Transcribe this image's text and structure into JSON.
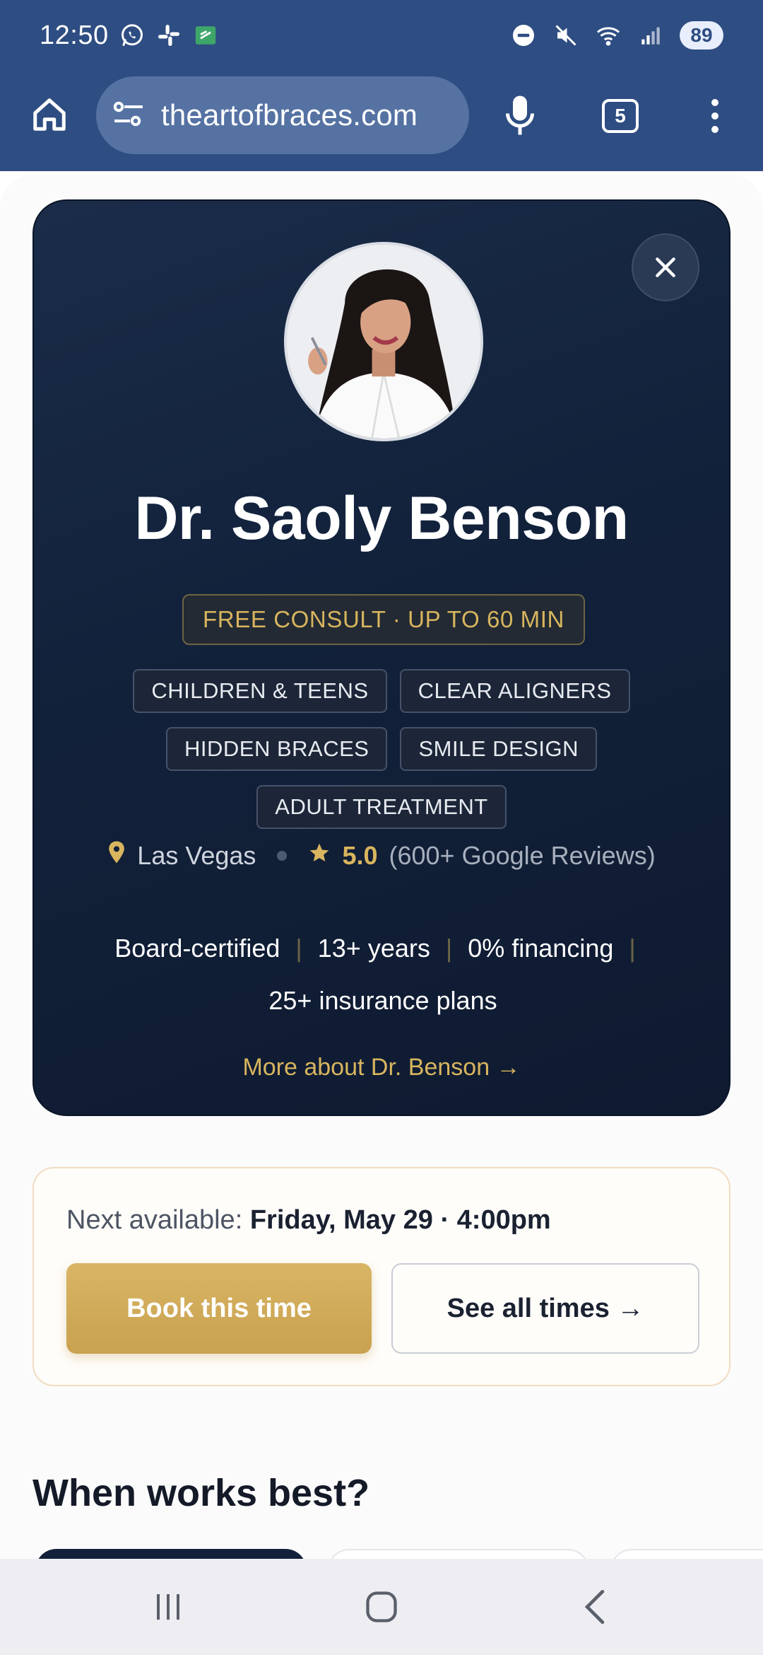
{
  "status_bar": {
    "time": "12:50",
    "battery": "89"
  },
  "browser": {
    "url": "theartofbraces.com",
    "tab_count": "5"
  },
  "profile": {
    "name": "Dr. Saoly Benson",
    "consult_badge": "FREE CONSULT · UP TO 60 MIN",
    "tag_rows": [
      [
        "CHILDREN & TEENS",
        "CLEAR ALIGNERS"
      ],
      [
        "HIDDEN BRACES",
        "SMILE DESIGN"
      ],
      [
        "ADULT TREATMENT"
      ]
    ],
    "city": "Las Vegas",
    "rating": "5.0",
    "reviews": "(600+ Google Reviews)",
    "credentials_line1": [
      "Board-certified",
      "13+ years",
      "0% financing"
    ],
    "credentials_line2": "25+ insurance plans",
    "more_link": "More about Dr. Benson →"
  },
  "booking": {
    "next_label": "Next available:",
    "next_value": "Friday, May 29 · 4:00pm",
    "book_label": "Book this time",
    "see_all_label": "See all times →"
  },
  "section": {
    "when_title": "When works best?"
  },
  "colors": {
    "chrome": "#2e4d82",
    "card": "#12213a",
    "gold": "#d8b55e",
    "book_button": "#cfa955"
  },
  "icons": {
    "home": "home-icon",
    "site_settings": "tune-icon",
    "mic": "mic-icon",
    "menu": "more-vert-icon",
    "close": "close-icon",
    "location": "location-pin-icon",
    "star": "star-icon"
  }
}
